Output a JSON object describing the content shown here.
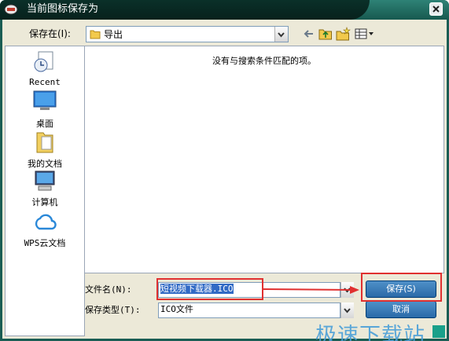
{
  "window": {
    "title": "当前图标保存为"
  },
  "toolbar": {
    "save_in_label": "保存在(I):",
    "current_folder": "导出",
    "icons": [
      "back-arrow-icon",
      "up-folder-icon",
      "new-folder-icon",
      "view-menu-icon"
    ]
  },
  "places": [
    {
      "label": "Recent",
      "icon": "recent-documents-icon"
    },
    {
      "label": "桌面",
      "icon": "desktop-icon"
    },
    {
      "label": "我的文档",
      "icon": "my-documents-icon"
    },
    {
      "label": "计算机",
      "icon": "computer-icon"
    },
    {
      "label": "WPS云文档",
      "icon": "wps-cloud-icon"
    }
  ],
  "filelist": {
    "empty_message": "没有与搜索条件匹配的项。"
  },
  "filename": {
    "label": "文件名(N):",
    "value": "短视频下载器.ICO"
  },
  "filetype": {
    "label": "保存类型(T):",
    "value": "ICO文件"
  },
  "buttons": {
    "save": "保存(S)",
    "cancel": "取消"
  },
  "watermark": "极速下载站",
  "colors": {
    "title_bar": "#17594f",
    "button": "#2a6aa8",
    "annotation": "#e03030",
    "watermark": "#4a9fd8"
  }
}
